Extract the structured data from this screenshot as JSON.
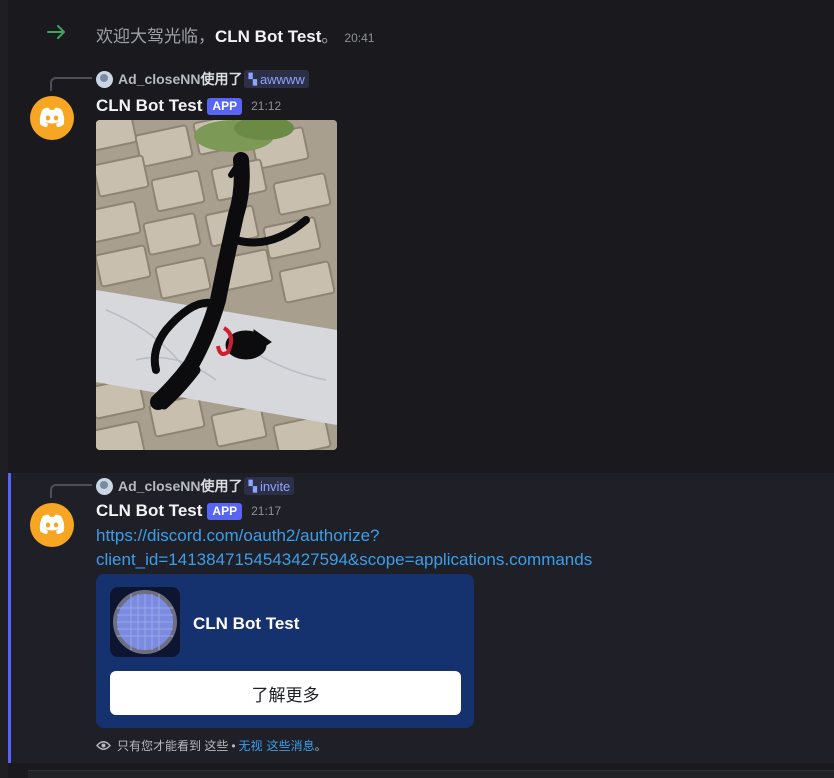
{
  "system_message": {
    "prefix": "欢迎大驾光临，",
    "name": "CLN Bot Test",
    "suffix": "。",
    "time": "20:41"
  },
  "messages": [
    {
      "reply": {
        "user": "Ad_closeNN",
        "used_text": "使用了",
        "command": "awwww"
      },
      "author": "CLN Bot Test",
      "badge": "APP",
      "time": "21:12",
      "attachment": "black-cat-photo"
    },
    {
      "reply": {
        "user": "Ad_closeNN",
        "used_text": "使用了",
        "command": "invite"
      },
      "author": "CLN Bot Test",
      "badge": "APP",
      "time": "21:17",
      "link_line1": "https://discord.com/oauth2/authorize?",
      "link_line2": "client_id=1413847154543427594&scope=applications.commands",
      "embed": {
        "title": "CLN Bot Test",
        "button_label": "了解更多"
      },
      "ephemeral": {
        "text": "只有您才能看到 这些",
        "dot": "•",
        "dismiss_prefix": "无视",
        "dismiss_link": "这些消息",
        "dismiss_suffix": "。"
      }
    }
  ],
  "colors": {
    "background": "#1a1a1e",
    "accent": "#5865f2",
    "link": "#3d9ee8",
    "bot_avatar": "#f6a623",
    "join_arrow": "#3ba55c",
    "embed_bg": "#15316e"
  },
  "icons": [
    "join-arrow-icon",
    "discord-logo-icon",
    "slash-command-icon",
    "eye-icon"
  ]
}
